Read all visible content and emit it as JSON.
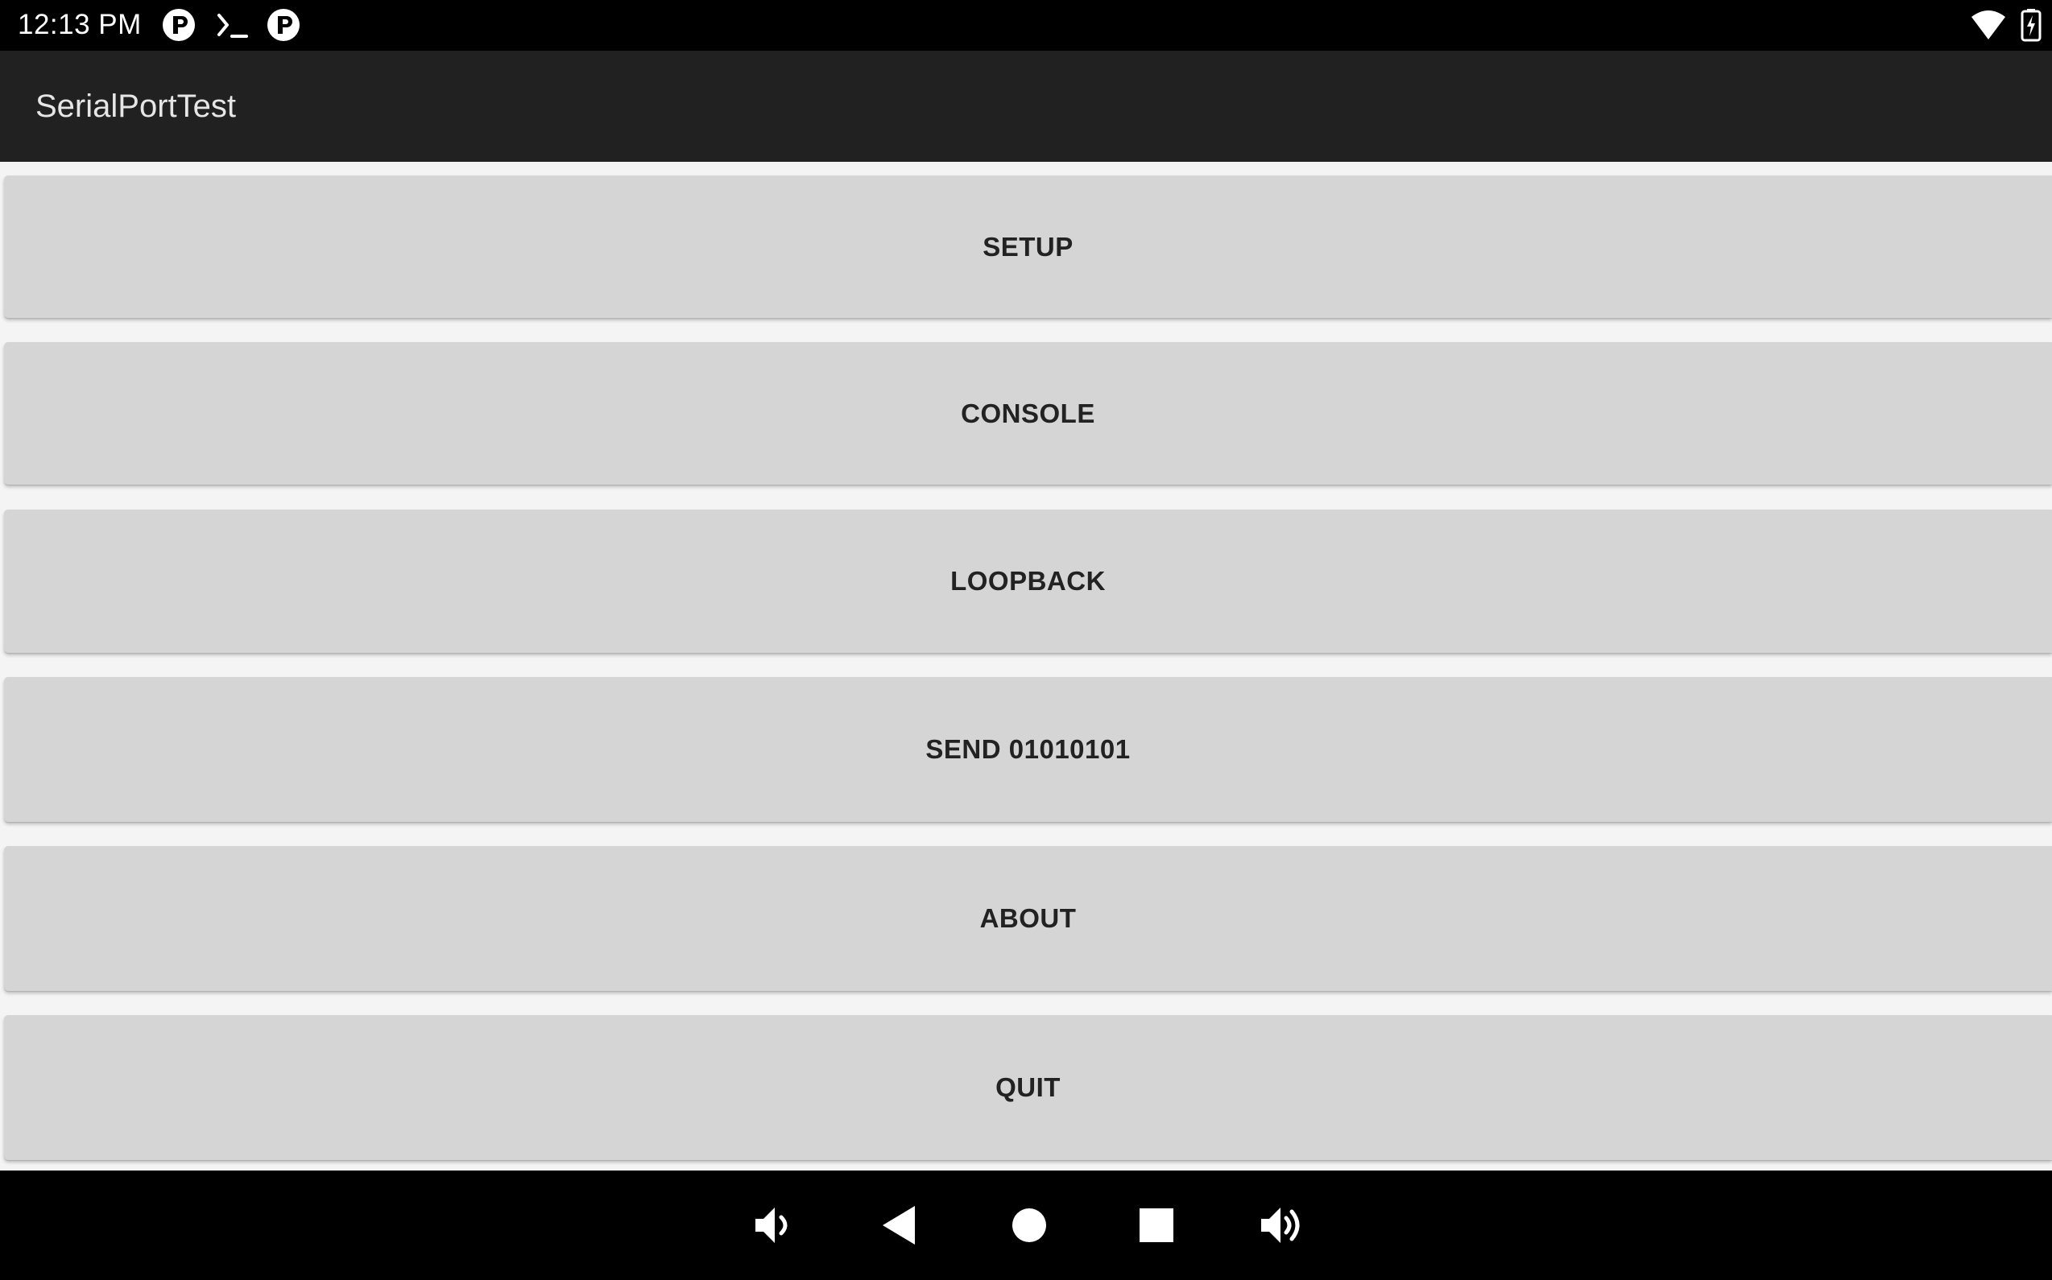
{
  "status_bar": {
    "time": "12:13 PM",
    "left_icons": [
      "p-circle-icon",
      "terminal-icon",
      "p-circle-icon"
    ],
    "right_icons": [
      "wifi-icon",
      "battery-charging-icon"
    ]
  },
  "app_bar": {
    "title": "SerialPortTest"
  },
  "buttons": [
    {
      "label": "SETUP"
    },
    {
      "label": "CONSOLE"
    },
    {
      "label": "LOOPBACK"
    },
    {
      "label": "SEND 01010101"
    },
    {
      "label": "ABOUT"
    },
    {
      "label": "QUIT"
    }
  ],
  "nav_bar": {
    "icons": [
      "volume-down-icon",
      "back-icon",
      "home-icon",
      "recents-icon",
      "volume-up-icon"
    ]
  },
  "colors": {
    "status_bar": "#000000",
    "app_bar": "#212121",
    "background": "#f4f4f4",
    "button": "#d5d5d5",
    "button_text": "#222222",
    "nav_bar": "#000000"
  }
}
